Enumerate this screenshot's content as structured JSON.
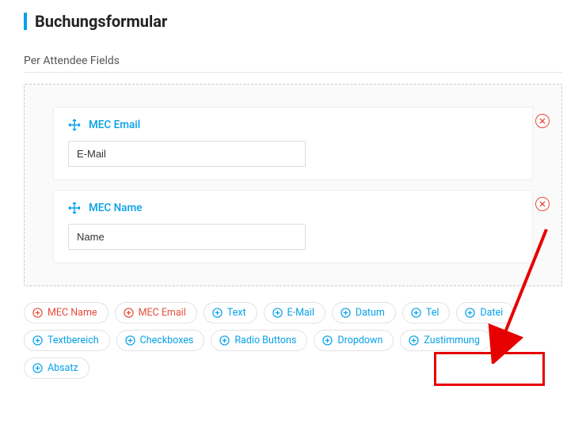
{
  "title": "Buchungsformular",
  "section_label": "Per Attendee Fields",
  "fields": [
    {
      "header": "MEC Email",
      "value": "E-Mail"
    },
    {
      "header": "MEC Name",
      "value": "Name"
    }
  ],
  "chips": [
    {
      "label": "MEC Name",
      "color": "red"
    },
    {
      "label": "MEC Email",
      "color": "red"
    },
    {
      "label": "Text",
      "color": "blue"
    },
    {
      "label": "E-Mail",
      "color": "blue"
    },
    {
      "label": "Datum",
      "color": "blue"
    },
    {
      "label": "Tel",
      "color": "blue"
    },
    {
      "label": "Datei",
      "color": "blue"
    },
    {
      "label": "Textbereich",
      "color": "blue"
    },
    {
      "label": "Checkboxes",
      "color": "blue"
    },
    {
      "label": "Radio Buttons",
      "color": "blue"
    },
    {
      "label": "Dropdown",
      "color": "blue"
    },
    {
      "label": "Zustimmung",
      "color": "blue"
    },
    {
      "label": "Absatz",
      "color": "blue"
    }
  ]
}
